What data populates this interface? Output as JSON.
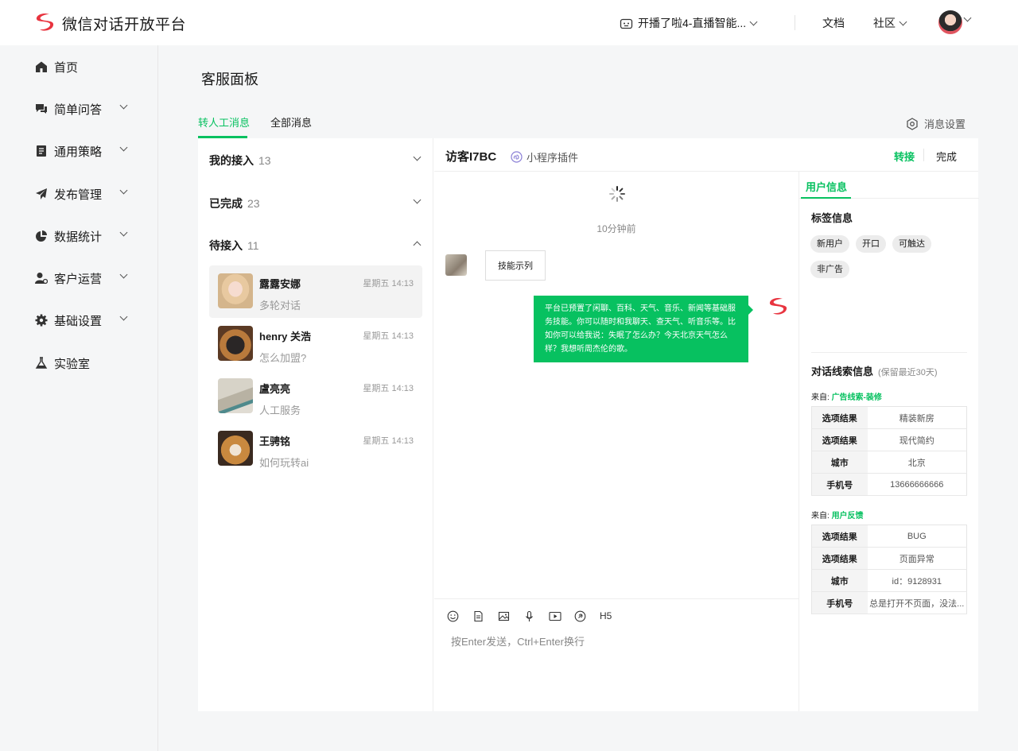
{
  "header": {
    "brand": "微信对话开放平台",
    "bot_name": "开播了啦4-直播智能...",
    "nav_docs": "文档",
    "nav_community": "社区"
  },
  "sidebar": {
    "items": [
      {
        "label": "首页",
        "icon": "home-icon",
        "has_chevron": false
      },
      {
        "label": "简单问答",
        "icon": "qa-icon",
        "has_chevron": true
      },
      {
        "label": "通用策略",
        "icon": "strategy-icon",
        "has_chevron": true
      },
      {
        "label": "发布管理",
        "icon": "publish-icon",
        "has_chevron": true
      },
      {
        "label": "数据统计",
        "icon": "stats-icon",
        "has_chevron": true
      },
      {
        "label": "客户运营",
        "icon": "customer-icon",
        "has_chevron": true
      },
      {
        "label": "基础设置",
        "icon": "settings-icon",
        "has_chevron": true
      },
      {
        "label": "实验室",
        "icon": "lab-icon",
        "has_chevron": false
      }
    ]
  },
  "page": {
    "title": "客服面板",
    "tabs": [
      "转人工消息",
      "全部消息"
    ],
    "message_settings": "消息设置"
  },
  "conversations": {
    "groups": [
      {
        "label": "我的接入",
        "count": "13"
      },
      {
        "label": "已完成",
        "count": "23"
      },
      {
        "label": "待接入",
        "count": "11"
      }
    ],
    "items": [
      {
        "name": "露露安娜",
        "time": "星期五 14:13",
        "preview": "多轮对话"
      },
      {
        "name": "henry 关浩",
        "time": "星期五 14:13",
        "preview": "怎么加盟?"
      },
      {
        "name": "盧亮亮",
        "time": "星期五 14:13",
        "preview": "人工服务"
      },
      {
        "name": "王骋铭",
        "time": "星期五 14:13",
        "preview": "如何玩转ai"
      }
    ]
  },
  "chat": {
    "visitor": "访客I7BC",
    "source": "小程序插件",
    "transfer": "转接",
    "done": "完成",
    "timestamp": "10分钟前",
    "user_message": "技能示列",
    "bot_message": "平台已预置了闲聊、百科、天气、音乐、新闻等基础服务技能。你可以随时和我聊天、查天气、听音乐等。比如你可以给我说：失眠了怎么办？今天北京天气怎么样？我想听周杰伦的歌。",
    "toolbar_h5": "H5",
    "input_placeholder": "按Enter发送，Ctrl+Enter换行"
  },
  "user_info": {
    "tab": "用户信息",
    "tags_title": "标签信息",
    "tags": [
      "新用户",
      "开口",
      "可触达",
      "非广告"
    ],
    "leads_title": "对话线索信息",
    "leads_note": "(保留最近30天)",
    "from_label": "来自:",
    "sources": [
      {
        "name": "广告线索-装修",
        "rows": [
          {
            "k": "选项结果",
            "v": "精装新房"
          },
          {
            "k": "选项结果",
            "v": "现代简约"
          },
          {
            "k": "城市",
            "v": "北京"
          },
          {
            "k": "手机号",
            "v": "13666666666"
          }
        ]
      },
      {
        "name": "用户反馈",
        "rows": [
          {
            "k": "选项结果",
            "v": "BUG"
          },
          {
            "k": "选项结果",
            "v": "页面异常"
          },
          {
            "k": "城市",
            "v": "id：9128931"
          },
          {
            "k": "手机号",
            "v": "总是打开不页面，没法..."
          }
        ]
      }
    ]
  },
  "colors": {
    "accent": "#07c160",
    "brand_red": "#e8343f"
  }
}
